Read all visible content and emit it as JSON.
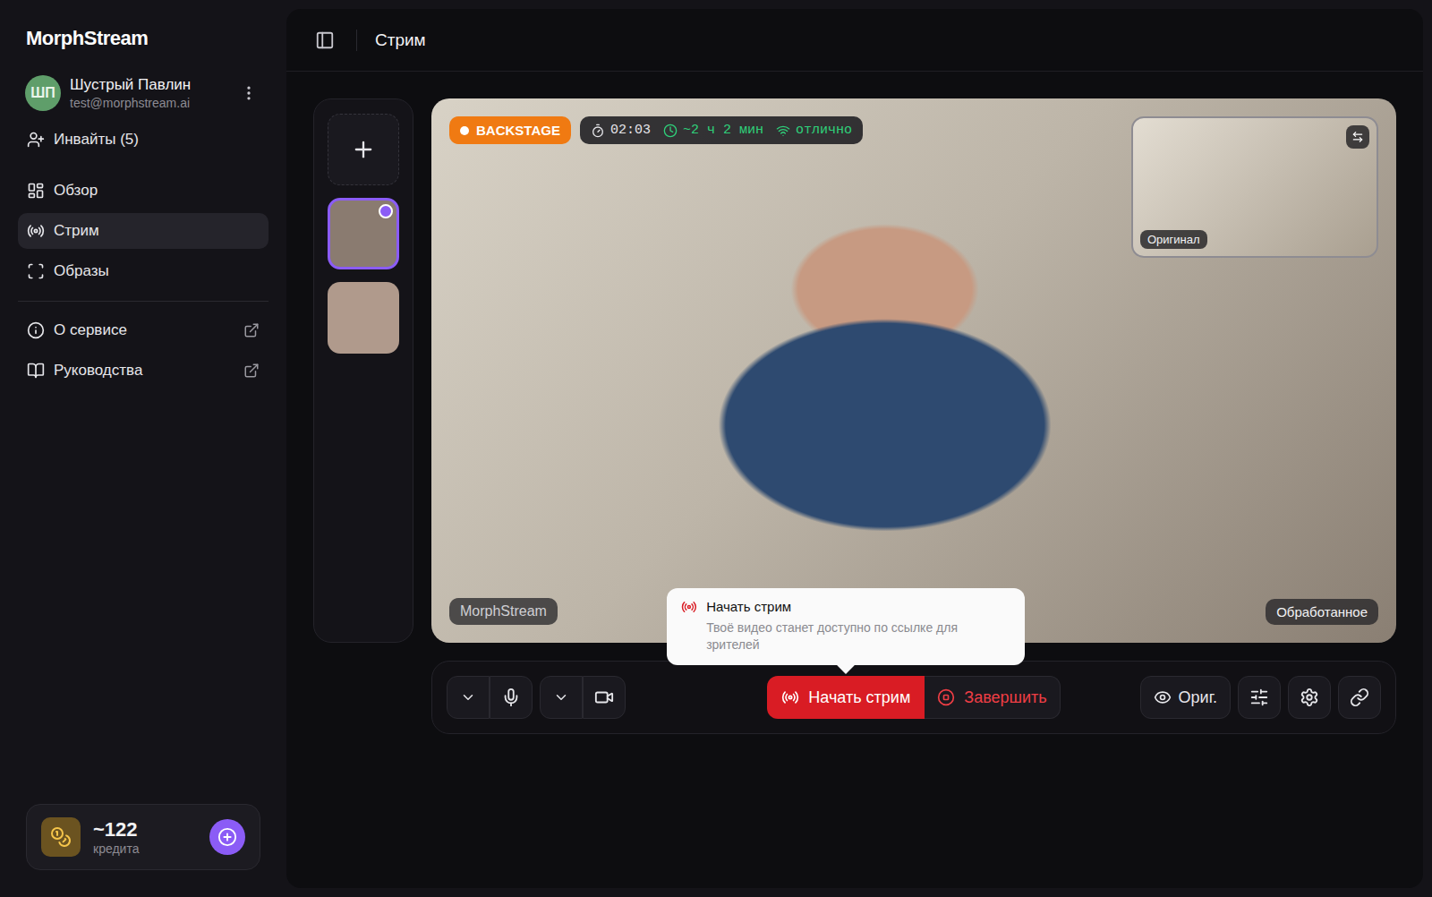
{
  "sidebar": {
    "logo": "MorphStream",
    "user": {
      "initials": "ШП",
      "name": "Шустрый Павлин",
      "email": "test@morphstream.ai"
    },
    "invites": "Инвайты (5)",
    "nav": [
      {
        "label": "Обзор",
        "icon": "overview",
        "selected": false,
        "external": false
      },
      {
        "label": "Стрим",
        "icon": "stream",
        "selected": true,
        "external": false
      },
      {
        "label": "Образы",
        "icon": "looks",
        "selected": false,
        "external": false
      }
    ],
    "links": [
      {
        "label": "О сервисе",
        "icon": "info",
        "external": true
      },
      {
        "label": "Руководства",
        "icon": "guides",
        "external": true
      }
    ],
    "credits": {
      "amount": "~122",
      "label": "кредита"
    }
  },
  "header": {
    "title": "Стрим"
  },
  "looks": [
    {
      "selected": true,
      "color": "#8a7b70"
    },
    {
      "selected": false,
      "color": "#b09a8c"
    }
  ],
  "video": {
    "status": "BACKSTAGE",
    "timer": "02:03",
    "remaining": "~2 ч 2 мин",
    "connection": "отлично",
    "pip_label": "Оригинал",
    "watermark": "MorphStream",
    "view_label": "Обработанное"
  },
  "controls": {
    "start": "Начать стрим",
    "stop": "Завершить",
    "view": "Ориг."
  },
  "tooltip": {
    "title": "Начать стрим",
    "text": "Твоё видео станет доступно по ссылке для зрителей"
  }
}
